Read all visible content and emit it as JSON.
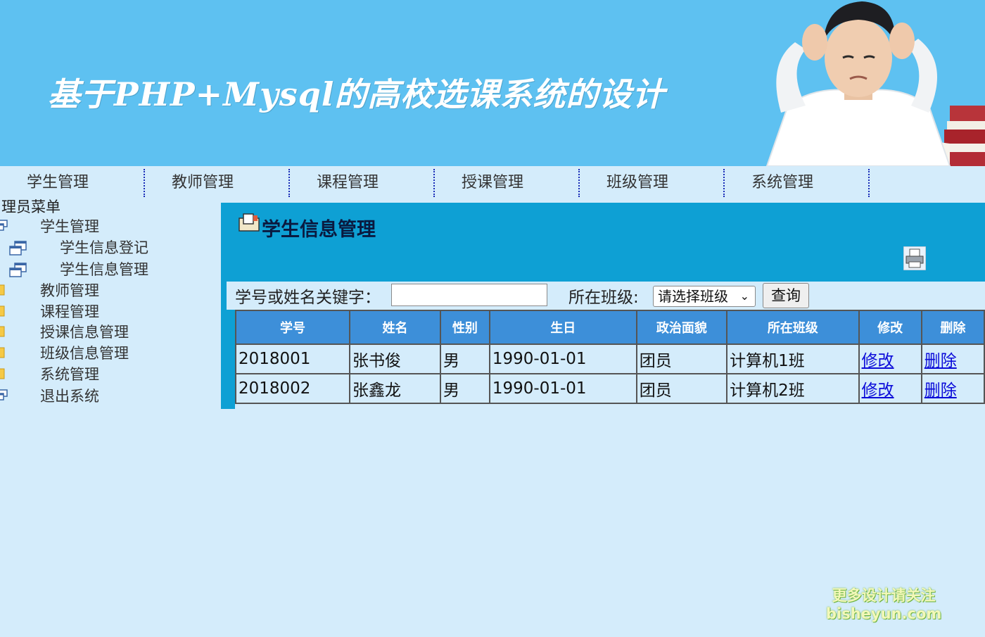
{
  "banner": {
    "title": "基于PHP+Mysql的高校选课系统的设计"
  },
  "topnav": {
    "items": [
      {
        "label": "学生管理"
      },
      {
        "label": "教师管理"
      },
      {
        "label": "课程管理"
      },
      {
        "label": "授课管理"
      },
      {
        "label": "班级管理"
      },
      {
        "label": "系统管理"
      }
    ]
  },
  "sidebar": {
    "title": "理员菜单",
    "items": [
      {
        "label": "学生管理",
        "icon": "window-icon"
      },
      {
        "label": "学生信息登记",
        "icon": "window-icon"
      },
      {
        "label": "学生信息管理",
        "icon": "window-icon"
      },
      {
        "label": "教师管理",
        "icon": "folder-icon"
      },
      {
        "label": "课程管理",
        "icon": "folder-icon"
      },
      {
        "label": "授课信息管理",
        "icon": "folder-icon"
      },
      {
        "label": "班级信息管理",
        "icon": "folder-icon"
      },
      {
        "label": "系统管理",
        "icon": "folder-icon"
      },
      {
        "label": "退出系统",
        "icon": "window-icon"
      }
    ]
  },
  "panel": {
    "title": "学生信息管理",
    "search": {
      "label": "学号或姓名关键字：",
      "value": "",
      "class_label": "所在班级:",
      "class_selected": "请选择班级",
      "query_label": "查询"
    },
    "table": {
      "headers": [
        "学号",
        "姓名",
        "性别",
        "生日",
        "政治面貌",
        "所在班级",
        "修改",
        "删除"
      ],
      "rows": [
        {
          "id": "2018001",
          "name": "张书俊",
          "gender": "男",
          "birthday": "1990-01-01",
          "political": "团员",
          "class": "计算机1班",
          "edit": "修改",
          "delete": "删除"
        },
        {
          "id": "2018002",
          "name": "张鑫龙",
          "gender": "男",
          "birthday": "1990-01-01",
          "political": "团员",
          "class": "计算机2班",
          "edit": "修改",
          "delete": "删除"
        }
      ]
    }
  },
  "watermark": {
    "line1": "更多设计请关注",
    "line2": "bisheyun.com"
  },
  "colors": {
    "banner": "#5ec1f1",
    "page_bg": "#d4ecfb",
    "panel": "#0ea0d4",
    "table_header": "#3d8fd9",
    "link": "#0b0bd9"
  }
}
